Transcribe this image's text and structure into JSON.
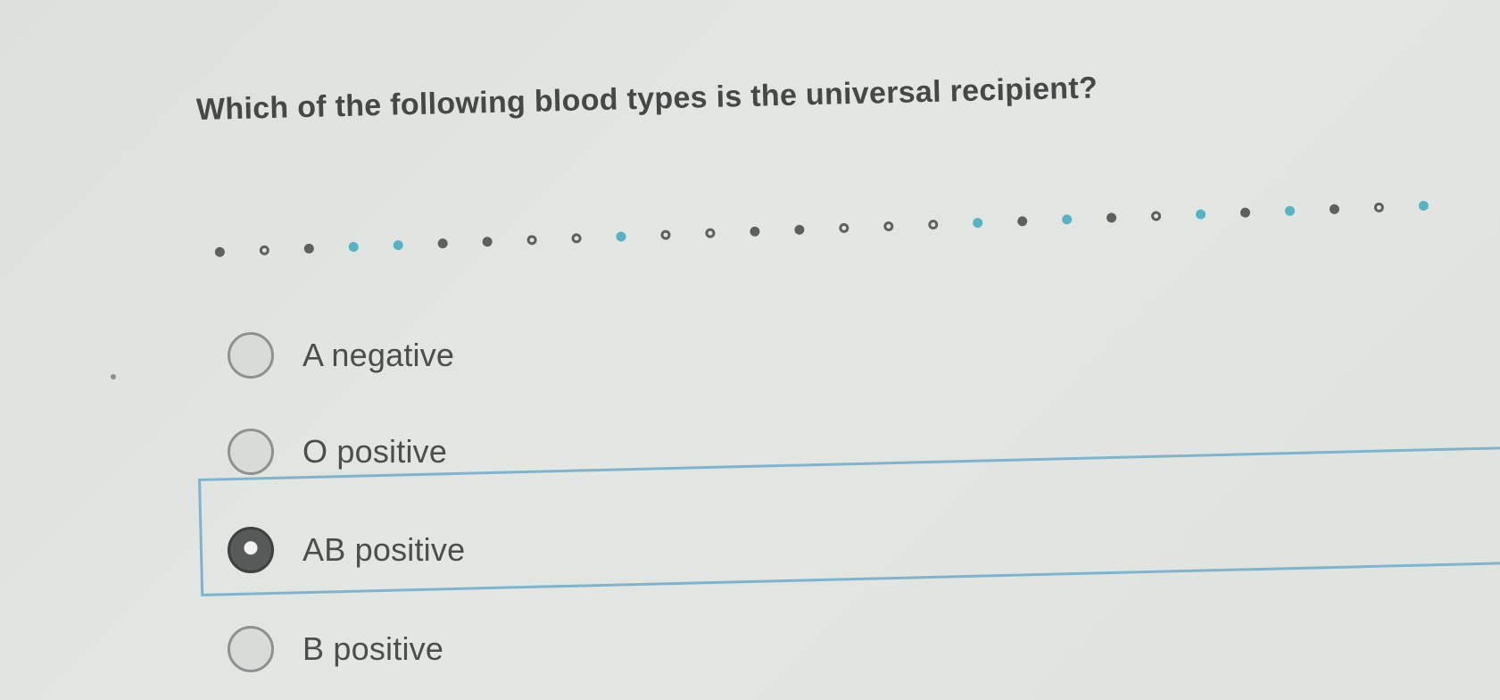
{
  "question": {
    "text": "Which of the following blood types is the universal recipient?"
  },
  "progress_dots": [
    {
      "state": "filled"
    },
    {
      "state": "hollow"
    },
    {
      "state": "filled"
    },
    {
      "state": "teal"
    },
    {
      "state": "teal"
    },
    {
      "state": "filled"
    },
    {
      "state": "filled"
    },
    {
      "state": "hollow"
    },
    {
      "state": "hollow"
    },
    {
      "state": "teal"
    },
    {
      "state": "hollow"
    },
    {
      "state": "hollow"
    },
    {
      "state": "filled"
    },
    {
      "state": "filled"
    },
    {
      "state": "hollow"
    },
    {
      "state": "hollow"
    },
    {
      "state": "hollow"
    },
    {
      "state": "teal"
    },
    {
      "state": "filled"
    },
    {
      "state": "teal"
    },
    {
      "state": "filled"
    },
    {
      "state": "hollow"
    },
    {
      "state": "teal"
    },
    {
      "state": "filled"
    },
    {
      "state": "teal"
    },
    {
      "state": "filled"
    },
    {
      "state": "hollow"
    },
    {
      "state": "teal"
    }
  ],
  "answers": {
    "selected_index": 2,
    "options": [
      {
        "label": "A negative",
        "selected": false
      },
      {
        "label": "O positive",
        "selected": false
      },
      {
        "label": "AB positive",
        "selected": true
      },
      {
        "label": "B positive",
        "selected": false
      }
    ]
  },
  "colors": {
    "background": "#e1e4df",
    "text": "#4b4e4c",
    "accent": "#55b3c6",
    "selection_border": "#7fb4cf"
  }
}
